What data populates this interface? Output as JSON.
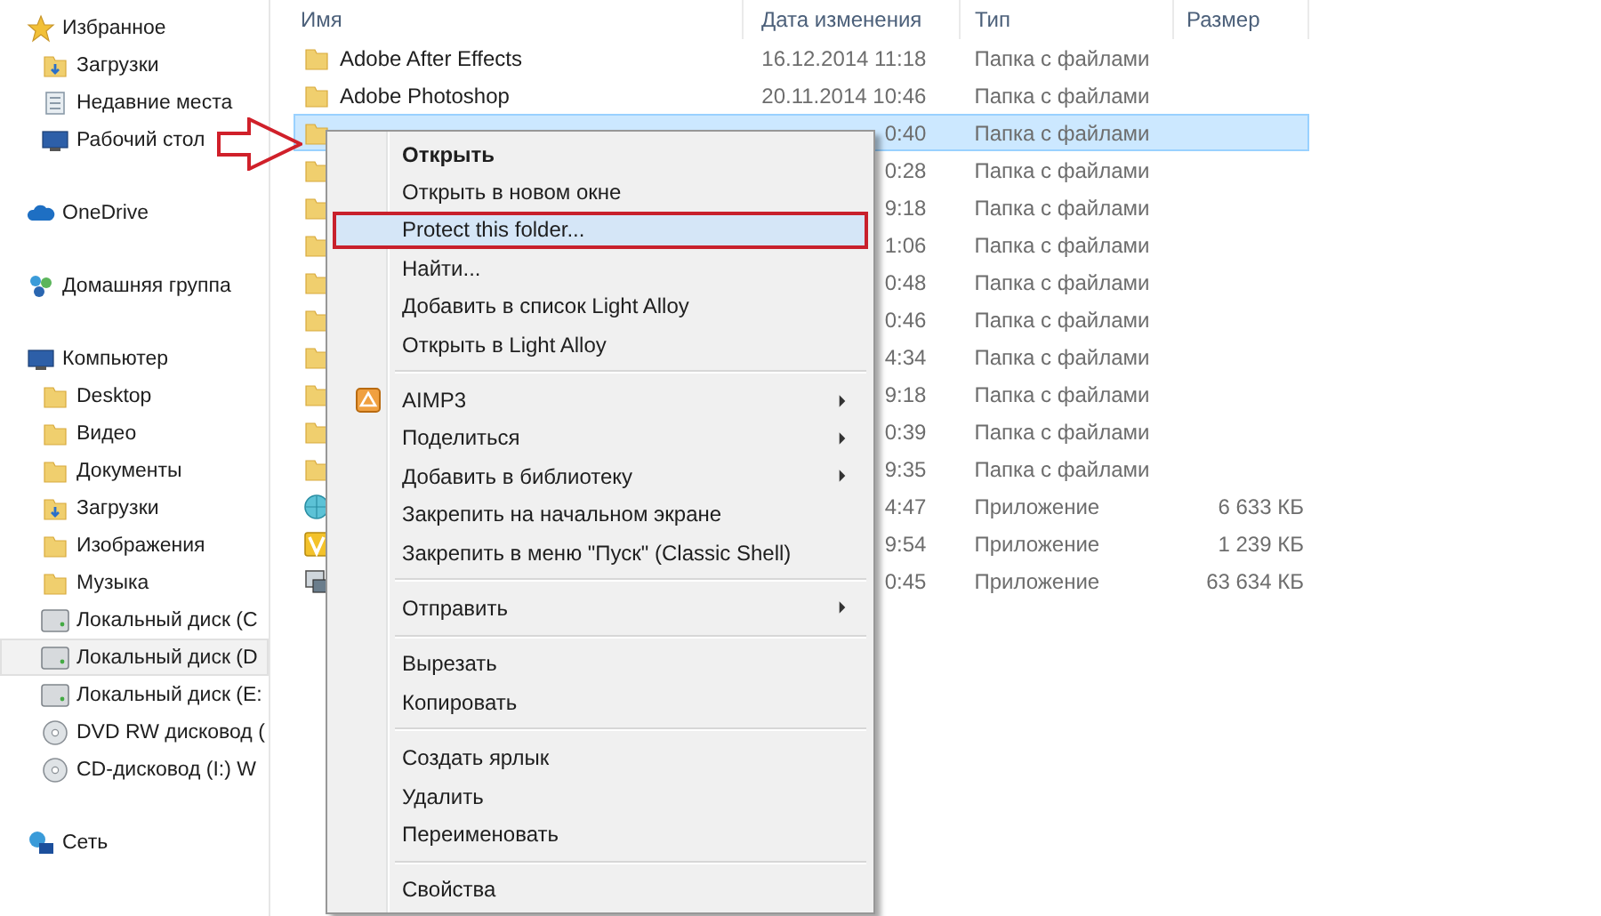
{
  "sidebar": {
    "groups": [
      {
        "label": "Избранное",
        "kind": "star",
        "selected": false,
        "children": [
          {
            "label": "Загрузки",
            "kind": "downloads",
            "selected": false
          },
          {
            "label": "Недавние места",
            "kind": "recent",
            "selected": false
          },
          {
            "label": "Рабочий стол",
            "kind": "desktop",
            "selected": false
          }
        ]
      },
      {
        "label": "OneDrive",
        "kind": "cloud",
        "selected": false
      },
      {
        "label": "Домашняя группа",
        "kind": "homegroup",
        "selected": false
      },
      {
        "label": "Компьютер",
        "kind": "computer",
        "selected": false,
        "children": [
          {
            "label": "Desktop",
            "kind": "folder",
            "selected": false
          },
          {
            "label": "Видео",
            "kind": "folder",
            "selected": false
          },
          {
            "label": "Документы",
            "kind": "folder",
            "selected": false
          },
          {
            "label": "Загрузки",
            "kind": "downloads",
            "selected": false
          },
          {
            "label": "Изображения",
            "kind": "folder",
            "selected": false
          },
          {
            "label": "Музыка",
            "kind": "folder",
            "selected": false
          },
          {
            "label": "Локальный диск (C",
            "kind": "disk",
            "selected": false
          },
          {
            "label": "Локальный диск (D",
            "kind": "disk",
            "selected": true
          },
          {
            "label": "Локальный диск (E:",
            "kind": "disk",
            "selected": false
          },
          {
            "label": "DVD RW дисковод (",
            "kind": "dvd",
            "selected": false
          },
          {
            "label": "CD-дисковод (I:) W",
            "kind": "cd",
            "selected": false
          }
        ]
      },
      {
        "label": "Сеть",
        "kind": "network",
        "selected": false
      }
    ]
  },
  "table": {
    "columns": [
      "Имя",
      "Дата изменения",
      "Тип",
      "Размер"
    ],
    "rows": [
      {
        "kind": "folder",
        "name": "Adobe After Effects",
        "date": "16.12.2014 11:18",
        "type": "Папка с файлами",
        "selected": false
      },
      {
        "kind": "folder",
        "name": "Adobe Photoshop",
        "date": "20.11.2014 10:46",
        "type": "Папка с файлами",
        "selected": false
      },
      {
        "kind": "folder",
        "date": "0:40",
        "type": "Папка с файлами",
        "selected": true
      },
      {
        "kind": "folder",
        "date": "0:28",
        "type": "Папка с файлами",
        "selected": false
      },
      {
        "kind": "folder",
        "date": "9:18",
        "type": "Папка с файлами",
        "selected": false
      },
      {
        "kind": "folder",
        "date": "1:06",
        "type": "Папка с файлами",
        "selected": false
      },
      {
        "kind": "folder",
        "date": "0:48",
        "type": "Папка с файлами",
        "selected": false
      },
      {
        "kind": "folder",
        "date": "0:46",
        "type": "Папка с файлами",
        "selected": false
      },
      {
        "kind": "folder",
        "date": "4:34",
        "type": "Папка с файлами",
        "selected": false
      },
      {
        "kind": "folder",
        "date": "9:18",
        "type": "Папка с файлами",
        "selected": false
      },
      {
        "kind": "folder",
        "date": "0:39",
        "type": "Папка с файлами",
        "selected": false
      },
      {
        "kind": "folder",
        "date": "9:35",
        "type": "Папка с файлами",
        "selected": false
      },
      {
        "kind": "globe",
        "date": "4:47",
        "type": "Приложение",
        "size": "6 633 КБ",
        "selected": false
      },
      {
        "kind": "app",
        "date": "9:54",
        "type": "Приложение",
        "size": "1 239 КБ",
        "selected": false
      },
      {
        "kind": "setup",
        "date": "0:45",
        "type": "Приложение",
        "size": "63 634 КБ",
        "selected": false
      }
    ]
  },
  "context_menu": {
    "items": [
      {
        "kind": "item",
        "label": "Открыть",
        "bold": true,
        "submenu": false,
        "highlighted": false
      },
      {
        "kind": "item",
        "label": "Открыть в новом окне",
        "bold": false,
        "submenu": false,
        "highlighted": false
      },
      {
        "kind": "item",
        "label": "Protect this folder...",
        "bold": false,
        "submenu": false,
        "highlighted": true
      },
      {
        "kind": "item",
        "label": "Найти...",
        "bold": false,
        "submenu": false,
        "highlighted": false
      },
      {
        "kind": "item",
        "label": "Добавить в список Light Alloy",
        "bold": false,
        "submenu": false,
        "highlighted": false
      },
      {
        "kind": "item",
        "label": "Открыть в Light Alloy",
        "bold": false,
        "submenu": false,
        "highlighted": false
      },
      {
        "kind": "separator"
      },
      {
        "kind": "icon-item",
        "label": "AIMP3",
        "bold": false,
        "submenu": true,
        "highlighted": false
      },
      {
        "kind": "item",
        "label": "Поделиться",
        "bold": false,
        "submenu": true,
        "highlighted": false
      },
      {
        "kind": "item",
        "label": "Добавить в библиотеку",
        "bold": false,
        "submenu": true,
        "highlighted": false
      },
      {
        "kind": "item",
        "label": "Закрепить на начальном экране",
        "bold": false,
        "submenu": false,
        "highlighted": false
      },
      {
        "kind": "item",
        "label": "Закрепить в меню \"Пуск\" (Classic Shell)",
        "bold": false,
        "submenu": false,
        "highlighted": false
      },
      {
        "kind": "separator"
      },
      {
        "kind": "item",
        "label": "Отправить",
        "bold": false,
        "submenu": true,
        "highlighted": false
      },
      {
        "kind": "separator"
      },
      {
        "kind": "item",
        "label": "Вырезать",
        "bold": false,
        "submenu": false,
        "highlighted": false
      },
      {
        "kind": "item",
        "label": "Копировать",
        "bold": false,
        "submenu": false,
        "highlighted": false
      },
      {
        "kind": "separator"
      },
      {
        "kind": "item",
        "label": "Создать ярлык",
        "bold": false,
        "submenu": false,
        "highlighted": false
      },
      {
        "kind": "item",
        "label": "Удалить",
        "bold": false,
        "submenu": false,
        "highlighted": false
      },
      {
        "kind": "item",
        "label": "Переименовать",
        "bold": false,
        "submenu": false,
        "highlighted": false
      },
      {
        "kind": "separator"
      },
      {
        "kind": "item",
        "label": "Свойства",
        "bold": false,
        "submenu": false,
        "highlighted": false
      }
    ]
  }
}
